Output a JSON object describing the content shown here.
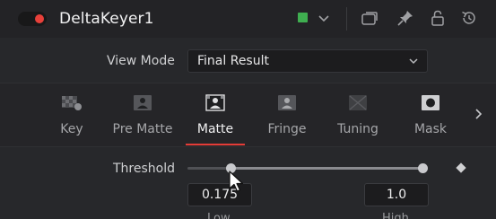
{
  "header": {
    "title": "DeltaKeyer1",
    "enabled": true,
    "toggle_color": "#e8403a",
    "swatch_color": "#3fae50",
    "icons": [
      "color-swatch",
      "chevron-down-icon",
      "version-icon",
      "pin-icon",
      "lock-icon",
      "reset-icon"
    ]
  },
  "view_mode": {
    "label": "View Mode",
    "value": "Final Result"
  },
  "tabs": [
    {
      "label": "Key",
      "icon": "key-icon"
    },
    {
      "label": "Pre Matte",
      "icon": "pre-matte-icon"
    },
    {
      "label": "Matte",
      "icon": "matte-icon",
      "active": true
    },
    {
      "label": "Fringe",
      "icon": "fringe-icon"
    },
    {
      "label": "Tuning",
      "icon": "tuning-icon"
    },
    {
      "label": "Mask",
      "icon": "mask-icon"
    }
  ],
  "threshold": {
    "label": "Threshold",
    "low_value": "0.175",
    "high_value": "1.0",
    "low_label": "Low",
    "high_label": "High",
    "accent": "#e33c37"
  }
}
